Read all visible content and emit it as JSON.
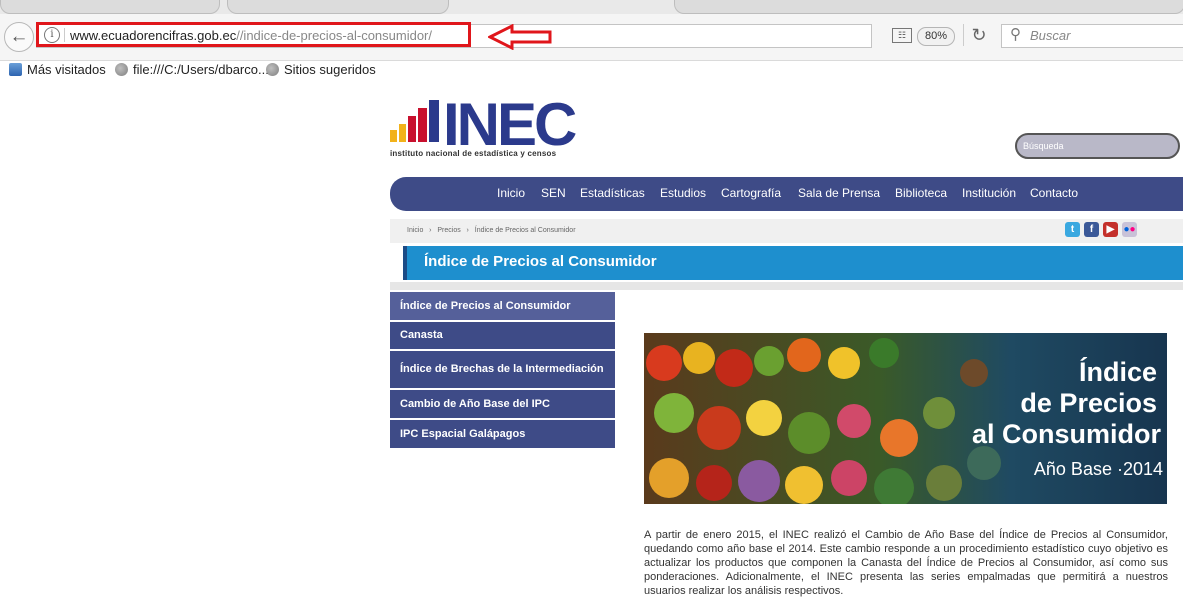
{
  "browser": {
    "url_domain": "www.ecuadorencifras.gob.ec",
    "url_path": "//indice-de-precios-al-consumidor/",
    "zoom": "80%",
    "search_placeholder": "Buscar",
    "bookmarks": [
      "Más visitados",
      "file:///C:/Users/dbarco...",
      "Sitios sugeridos"
    ]
  },
  "site": {
    "logo_word": "INEC",
    "logo_tagline": "instituto nacional de estadística y censos",
    "search_placeholder": "Búsqueda",
    "nav": [
      "Inicio",
      "SEN",
      "Estadísticas",
      "Estudios",
      "Cartografía",
      "Sala de Prensa",
      "Biblioteca",
      "Institución",
      "Contacto"
    ],
    "breadcrumb": [
      "Inicio",
      "Precios",
      "Índice de Precios al Consumidor"
    ],
    "page_title": "Índice de Precios al Consumidor",
    "side_menu": [
      "Índice de Precios al Consumidor",
      "Canasta",
      "Índice de Brechas de la Intermediación",
      "Cambio de Año Base del IPC",
      "IPC Espacial Galápagos"
    ],
    "hero": {
      "line1": "Índice",
      "line2": "de Precios",
      "line3": "al Consumidor",
      "line4": "Año Base  ·2014"
    },
    "body_text": "A partir de enero 2015, el INEC realizó el Cambio de Año Base del Índice de Precios al Consumidor, quedando como año base el 2014. Este cambio responde a un procedimiento estadístico cuyo objetivo es actualizar los productos que componen la Canasta del Índice de Precios al Consumidor, así como sus ponderaciones. Adicionalmente, el INEC presenta las series empalmadas que permitirá a nuestros usuarios realizar los análisis respectivos."
  },
  "colors": {
    "nav_bg": "#3e4b87",
    "title_band": "#1e8fce",
    "highlight": "#e0161b",
    "logo_blue": "#2b3a8c"
  }
}
